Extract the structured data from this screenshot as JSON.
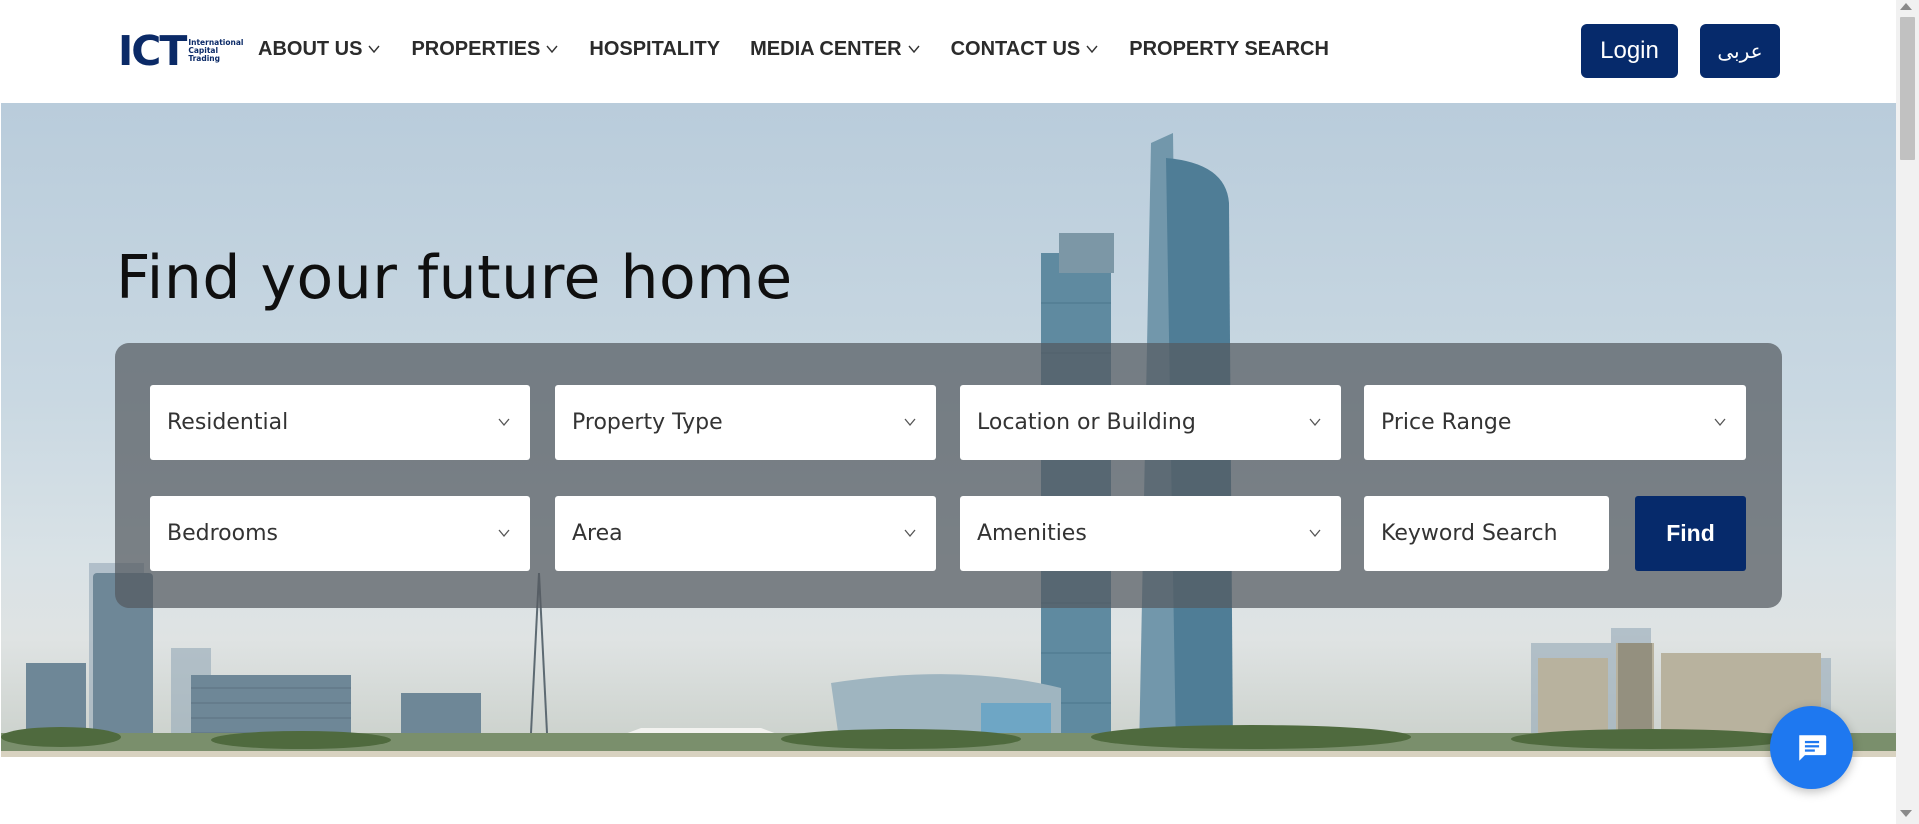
{
  "logo": {
    "mark": "ICT",
    "sub1": "International",
    "sub2": "Capital",
    "sub3": "Trading"
  },
  "nav": {
    "items": [
      {
        "label": "ABOUT US",
        "dropdown": true
      },
      {
        "label": "PROPERTIES",
        "dropdown": true
      },
      {
        "label": "HOSPITALITY",
        "dropdown": false
      },
      {
        "label": "MEDIA CENTER",
        "dropdown": true
      },
      {
        "label": "CONTACT US",
        "dropdown": true
      },
      {
        "label": "PROPERTY SEARCH",
        "dropdown": false
      }
    ],
    "login_label": "Login",
    "lang_label": "عربى"
  },
  "hero": {
    "headline": "Find your future home"
  },
  "search": {
    "category": "Residential",
    "property_type": "Property Type",
    "location": "Location or Building",
    "price_range": "Price Range",
    "bedrooms": "Bedrooms",
    "area": "Area",
    "amenities": "Amenities",
    "keyword_placeholder": "Keyword Search",
    "find_label": "Find"
  },
  "colors": {
    "brand_navy": "#062a6b",
    "chat_blue": "#1e78f0",
    "panel_overlay": "rgba(85,90,96,0.72)"
  },
  "icons": {
    "chat": "chat-bubble-icon",
    "dropdown": "chevron-down-icon"
  }
}
